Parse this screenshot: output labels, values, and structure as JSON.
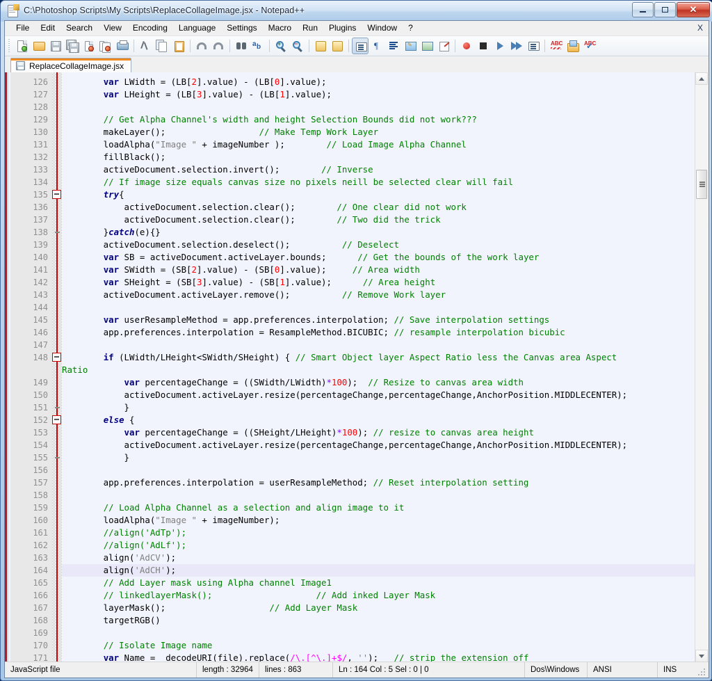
{
  "window": {
    "title": "C:\\Photoshop Scripts\\My Scripts\\ReplaceCollageImage.jsx - Notepad++",
    "icon": "notepad-plus-plus-icon",
    "buttons": {
      "minimize": "minimize",
      "maximize": "maximize",
      "close": "✕"
    }
  },
  "menubar": {
    "items": [
      "File",
      "Edit",
      "Search",
      "View",
      "Encoding",
      "Language",
      "Settings",
      "Macro",
      "Run",
      "Plugins",
      "Window",
      "?"
    ],
    "close_document_label": "X"
  },
  "toolbar": {
    "icons": [
      "new-file-icon",
      "open-file-icon",
      "save-icon",
      "save-all-icon",
      "close-file-icon",
      "close-all-files-icon",
      "print-icon",
      "cut-icon",
      "copy-icon",
      "paste-icon",
      "undo-icon",
      "redo-icon",
      "find-icon",
      "replace-icon",
      "zoom-in-icon",
      "zoom-out-icon",
      "sync-vertical-scroll-icon",
      "sync-horizontal-scroll-icon",
      "word-wrap-icon",
      "show-all-characters-icon",
      "indent-guide-icon",
      "user-defined-dialog-icon",
      "document-map-icon",
      "function-list-icon",
      "record-macro-icon",
      "stop-recording-icon",
      "play-macro-icon",
      "run-macro-multiple-icon",
      "save-macro-icon",
      "spell-check-icon",
      "run-icon",
      "spell-check-ok-icon"
    ]
  },
  "tabs": [
    {
      "label": "ReplaceCollageImage.jsx",
      "icon": "saved-file-icon",
      "active": true
    }
  ],
  "editor": {
    "current_line": 164,
    "first_visible_line": 126,
    "lines": [
      {
        "n": 126,
        "fold": "none",
        "tokens": [
          [
            "plain",
            "        "
          ],
          [
            "kw",
            "var"
          ],
          [
            "plain",
            " LWidth = (LB["
          ],
          [
            "num",
            "2"
          ],
          [
            "plain",
            "].value) - (LB["
          ],
          [
            "num",
            "0"
          ],
          [
            "plain",
            "].value);"
          ]
        ]
      },
      {
        "n": 127,
        "fold": "none",
        "tokens": [
          [
            "plain",
            "        "
          ],
          [
            "kw",
            "var"
          ],
          [
            "plain",
            " LHeight = (LB["
          ],
          [
            "num",
            "3"
          ],
          [
            "plain",
            "].value) - (LB["
          ],
          [
            "num",
            "1"
          ],
          [
            "plain",
            "].value);"
          ]
        ]
      },
      {
        "n": 128,
        "fold": "none",
        "tokens": [
          [
            "plain",
            ""
          ]
        ]
      },
      {
        "n": 129,
        "fold": "none",
        "tokens": [
          [
            "plain",
            "        "
          ],
          [
            "cm",
            "// Get Alpha Channel's width and height Selection Bounds did not work???"
          ]
        ]
      },
      {
        "n": 130,
        "fold": "none",
        "tokens": [
          [
            "plain",
            "        makeLayer();                  "
          ],
          [
            "cm",
            "// Make Temp Work Layer"
          ]
        ]
      },
      {
        "n": 131,
        "fold": "none",
        "tokens": [
          [
            "plain",
            "        loadAlpha("
          ],
          [
            "str",
            "\"Image \""
          ],
          [
            "plain",
            " + imageNumber );        "
          ],
          [
            "cm",
            "// Load Image Alpha Channel"
          ]
        ]
      },
      {
        "n": 132,
        "fold": "none",
        "tokens": [
          [
            "plain",
            "        fillBlack();"
          ]
        ]
      },
      {
        "n": 133,
        "fold": "none",
        "tokens": [
          [
            "plain",
            "        activeDocument.selection.invert();        "
          ],
          [
            "cm",
            "// Inverse"
          ]
        ]
      },
      {
        "n": 134,
        "fold": "none",
        "tokens": [
          [
            "plain",
            "        "
          ],
          [
            "cm",
            "// If image size equals canvas size no pixels neill be selected clear will fail"
          ]
        ]
      },
      {
        "n": 135,
        "fold": "box",
        "tokens": [
          [
            "plain",
            "        "
          ],
          [
            "kwi",
            "try"
          ],
          [
            "plain",
            "{"
          ]
        ]
      },
      {
        "n": 136,
        "fold": "none",
        "tokens": [
          [
            "plain",
            "            activeDocument.selection.clear();        "
          ],
          [
            "cm",
            "// One clear did not work"
          ]
        ]
      },
      {
        "n": 137,
        "fold": "none",
        "tokens": [
          [
            "plain",
            "            activeDocument.selection.clear();        "
          ],
          [
            "cm",
            "// Two did the trick"
          ]
        ]
      },
      {
        "n": 138,
        "fold": "dash",
        "tokens": [
          [
            "plain",
            "        }"
          ],
          [
            "kwi",
            "catch"
          ],
          [
            "plain",
            "(e){}"
          ]
        ]
      },
      {
        "n": 139,
        "fold": "none",
        "tokens": [
          [
            "plain",
            "        activeDocument.selection.deselect();          "
          ],
          [
            "cm",
            "// Deselect"
          ]
        ]
      },
      {
        "n": 140,
        "fold": "none",
        "tokens": [
          [
            "plain",
            "        "
          ],
          [
            "kw",
            "var"
          ],
          [
            "plain",
            " SB = activeDocument.activeLayer.bounds;      "
          ],
          [
            "cm",
            "// Get the bounds of the work layer"
          ]
        ]
      },
      {
        "n": 141,
        "fold": "none",
        "tokens": [
          [
            "plain",
            "        "
          ],
          [
            "kw",
            "var"
          ],
          [
            "plain",
            " SWidth = (SB["
          ],
          [
            "num",
            "2"
          ],
          [
            "plain",
            "].value) - (SB["
          ],
          [
            "num",
            "0"
          ],
          [
            "plain",
            "].value);     "
          ],
          [
            "cm",
            "// Area width"
          ]
        ]
      },
      {
        "n": 142,
        "fold": "none",
        "tokens": [
          [
            "plain",
            "        "
          ],
          [
            "kw",
            "var"
          ],
          [
            "plain",
            " SHeight = (SB["
          ],
          [
            "num",
            "3"
          ],
          [
            "plain",
            "].value) - (SB["
          ],
          [
            "num",
            "1"
          ],
          [
            "plain",
            "].value);      "
          ],
          [
            "cm",
            "// Area height"
          ]
        ]
      },
      {
        "n": 143,
        "fold": "none",
        "tokens": [
          [
            "plain",
            "        activeDocument.activeLayer.remove();          "
          ],
          [
            "cm",
            "// Remove Work layer"
          ]
        ]
      },
      {
        "n": 144,
        "fold": "none",
        "tokens": [
          [
            "plain",
            ""
          ]
        ]
      },
      {
        "n": 145,
        "fold": "none",
        "tokens": [
          [
            "plain",
            "        "
          ],
          [
            "kw",
            "var"
          ],
          [
            "plain",
            " userResampleMethod = app.preferences.interpolation; "
          ],
          [
            "cm",
            "// Save interpolation settings"
          ]
        ]
      },
      {
        "n": 146,
        "fold": "none",
        "tokens": [
          [
            "plain",
            "        app.preferences.interpolation = ResampleMethod.BICUBIC; "
          ],
          [
            "cm",
            "// resample interpolation bicubic"
          ]
        ]
      },
      {
        "n": 147,
        "fold": "none",
        "tokens": [
          [
            "plain",
            ""
          ]
        ]
      },
      {
        "n": 148,
        "fold": "box",
        "tokens": [
          [
            "plain",
            "        "
          ],
          [
            "kw",
            "if"
          ],
          [
            "plain",
            " (LWidth/LHeight<SWidth/SHeight) { "
          ],
          [
            "cm",
            "// Smart Object layer Aspect Ratio less the Canvas area Aspect"
          ]
        ]
      },
      {
        "n": "",
        "fold": "none",
        "wrap": true,
        "tokens": [
          [
            "cm",
            "Ratio"
          ]
        ]
      },
      {
        "n": 149,
        "fold": "none",
        "tokens": [
          [
            "plain",
            "            "
          ],
          [
            "kw",
            "var"
          ],
          [
            "plain",
            " percentageChange = ((SWidth/LWidth)"
          ],
          [
            "op",
            "*"
          ],
          [
            "num",
            "100"
          ],
          [
            "plain",
            ");  "
          ],
          [
            "cm",
            "// Resize to canvas area width"
          ]
        ]
      },
      {
        "n": 150,
        "fold": "none",
        "tokens": [
          [
            "plain",
            "            activeDocument.activeLayer.resize(percentageChange,percentageChange,AnchorPosition.MIDDLECENTER);"
          ]
        ]
      },
      {
        "n": 151,
        "fold": "dash",
        "tokens": [
          [
            "plain",
            "            }"
          ]
        ]
      },
      {
        "n": 152,
        "fold": "box",
        "tokens": [
          [
            "plain",
            "        "
          ],
          [
            "kwi",
            "else"
          ],
          [
            "plain",
            " {"
          ]
        ]
      },
      {
        "n": 153,
        "fold": "none",
        "tokens": [
          [
            "plain",
            "            "
          ],
          [
            "kw",
            "var"
          ],
          [
            "plain",
            " percentageChange = ((SHeight/LHeight)"
          ],
          [
            "op",
            "*"
          ],
          [
            "num",
            "100"
          ],
          [
            "plain",
            "); "
          ],
          [
            "cm",
            "// resize to canvas area height"
          ]
        ]
      },
      {
        "n": 154,
        "fold": "none",
        "tokens": [
          [
            "plain",
            "            activeDocument.activeLayer.resize(percentageChange,percentageChange,AnchorPosition.MIDDLECENTER);"
          ]
        ]
      },
      {
        "n": 155,
        "fold": "dash",
        "tokens": [
          [
            "plain",
            "            }"
          ]
        ]
      },
      {
        "n": 156,
        "fold": "none",
        "tokens": [
          [
            "plain",
            ""
          ]
        ]
      },
      {
        "n": 157,
        "fold": "none",
        "tokens": [
          [
            "plain",
            "        app.preferences.interpolation = userResampleMethod; "
          ],
          [
            "cm",
            "// Reset interpolation setting"
          ]
        ]
      },
      {
        "n": 158,
        "fold": "none",
        "tokens": [
          [
            "plain",
            ""
          ]
        ]
      },
      {
        "n": 159,
        "fold": "none",
        "tokens": [
          [
            "plain",
            "        "
          ],
          [
            "cm",
            "// Load Alpha Channel as a selection and align image to it"
          ]
        ]
      },
      {
        "n": 160,
        "fold": "none",
        "tokens": [
          [
            "plain",
            "        loadAlpha("
          ],
          [
            "str",
            "\"Image \""
          ],
          [
            "plain",
            " + imageNumber);"
          ]
        ]
      },
      {
        "n": 161,
        "fold": "none",
        "tokens": [
          [
            "plain",
            "        "
          ],
          [
            "cm",
            "//align('AdTp');"
          ]
        ]
      },
      {
        "n": 162,
        "fold": "none",
        "tokens": [
          [
            "plain",
            "        "
          ],
          [
            "cm",
            "//align('AdLf');"
          ]
        ]
      },
      {
        "n": 163,
        "fold": "none",
        "tokens": [
          [
            "plain",
            "        align("
          ],
          [
            "str",
            "'AdCV'"
          ],
          [
            "plain",
            ");"
          ]
        ]
      },
      {
        "n": 164,
        "fold": "none",
        "current": true,
        "tokens": [
          [
            "plain",
            "        align("
          ],
          [
            "str",
            "'AdCH'"
          ],
          [
            "plain",
            ");"
          ]
        ]
      },
      {
        "n": 165,
        "fold": "none",
        "tokens": [
          [
            "plain",
            "        "
          ],
          [
            "cm",
            "// Add Layer mask using Alpha channel Image1"
          ]
        ]
      },
      {
        "n": 166,
        "fold": "none",
        "tokens": [
          [
            "plain",
            "        "
          ],
          [
            "cm",
            "// linkedlayerMask();"
          ],
          [
            "plain",
            "                    "
          ],
          [
            "cm",
            "// Add inked Layer Mask"
          ]
        ]
      },
      {
        "n": 167,
        "fold": "none",
        "tokens": [
          [
            "plain",
            "        layerMask();                    "
          ],
          [
            "cm",
            "// Add Layer Mask"
          ]
        ]
      },
      {
        "n": 168,
        "fold": "none",
        "tokens": [
          [
            "plain",
            "        targetRGB()"
          ]
        ]
      },
      {
        "n": 169,
        "fold": "none",
        "tokens": [
          [
            "plain",
            ""
          ]
        ]
      },
      {
        "n": 170,
        "fold": "none",
        "tokens": [
          [
            "plain",
            "        "
          ],
          [
            "cm",
            "// Isolate Image name"
          ]
        ]
      },
      {
        "n": 171,
        "fold": "none",
        "tokens": [
          [
            "plain",
            "        "
          ],
          [
            "kw",
            "var"
          ],
          [
            "plain",
            " Name =  decodeURI(file).replace("
          ],
          [
            "rx",
            "/\\.[^\\.]+$/"
          ],
          [
            "plain",
            ", "
          ],
          [
            "str",
            "''"
          ],
          [
            "plain",
            ");   "
          ],
          [
            "cm",
            "// strip the extension off"
          ]
        ]
      }
    ]
  },
  "scrollbar": {
    "up_arrow": "scroll-up-arrow",
    "down_arrow": "scroll-down-arrow"
  },
  "statusbar": {
    "file_type": "JavaScript file",
    "length": "length : 32964",
    "lines": "lines : 863",
    "position": "Ln : 164   Col : 5   Sel : 0 | 0",
    "eol": "Dos\\Windows",
    "encoding": "ANSI",
    "insert_mode": "INS"
  },
  "colors": {
    "keyword": "#000080",
    "comment": "#008000",
    "number": "#ff0000",
    "string": "#808080",
    "operator": "#8000ff",
    "regex": "#ff00ff",
    "editor_bg": "#f2f4fd",
    "current_line_bg": "#e8e8f8",
    "tab_accent": "#f08a1e",
    "fold_marker": "#cc0000"
  }
}
